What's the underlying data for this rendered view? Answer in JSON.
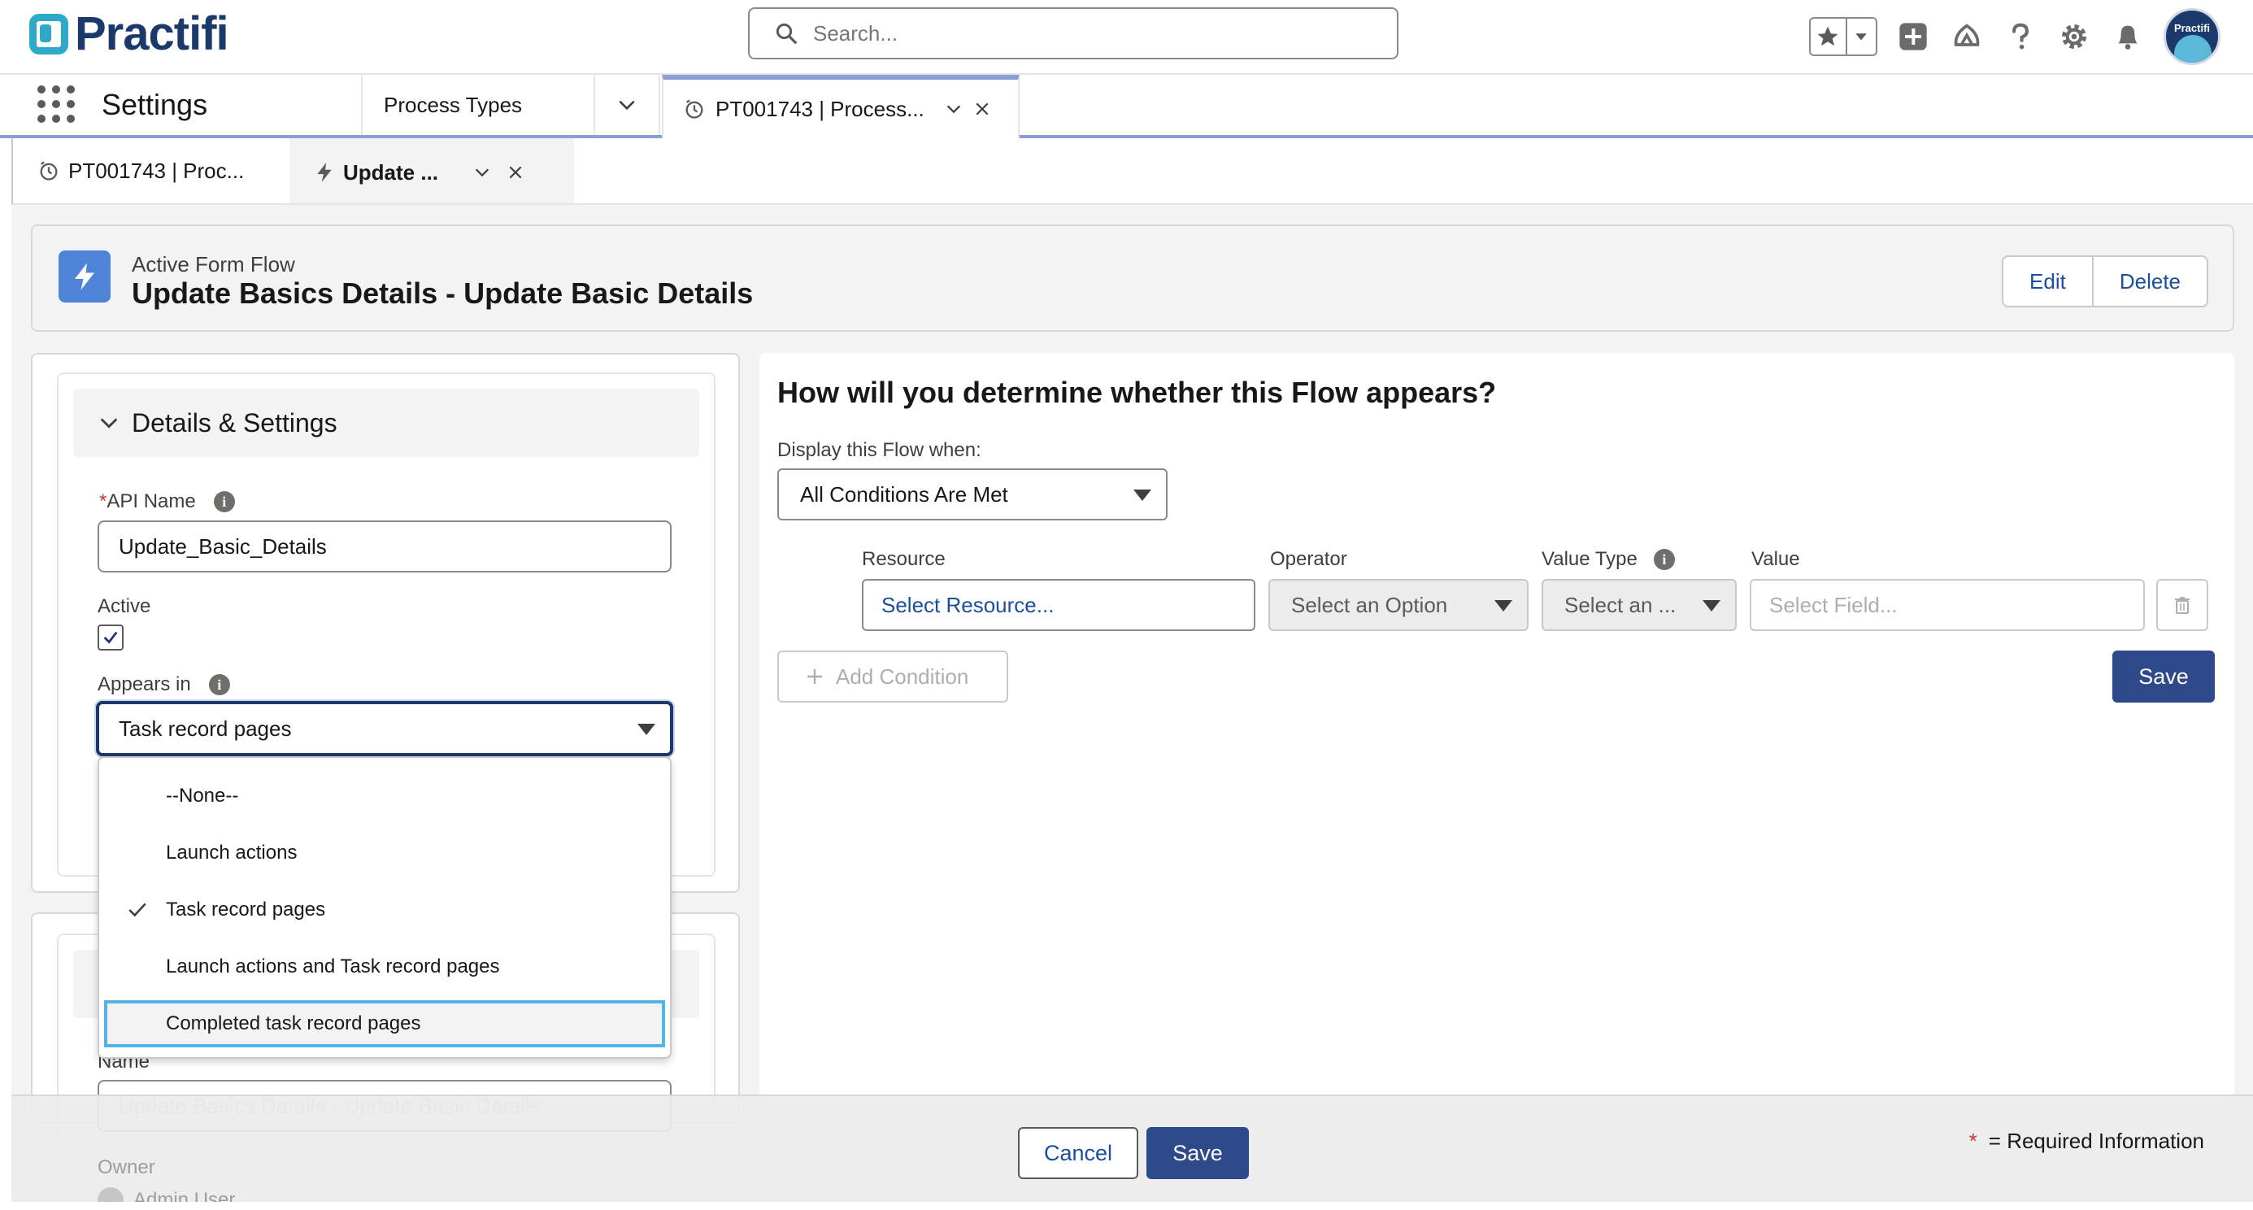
{
  "header": {
    "logo_text": "Practifi",
    "search_placeholder": "Search...",
    "avatar_text": "Practifi"
  },
  "app_nav": {
    "app_name": "Settings",
    "nav_item": "Process Types",
    "active_tab": "PT001743 | Process..."
  },
  "subtabs": [
    {
      "label": "PT001743 | Proc..."
    },
    {
      "label": "Update ..."
    }
  ],
  "record": {
    "type_label": "Active Form Flow",
    "title": "Update Basics Details - Update Basic Details",
    "edit_label": "Edit",
    "delete_label": "Delete"
  },
  "details": {
    "section_title": "Details & Settings",
    "api_name_label": "API Name",
    "api_name_required": "*",
    "api_name_value": "Update_Basic_Details",
    "active_label": "Active",
    "active_checked": true,
    "appears_in_label": "Appears in",
    "appears_in_value": "Task record pages",
    "name_label": "Name",
    "name_value": "Update Basics Details - Update Basic Details",
    "owner_label": "Owner",
    "owner_value": "Admin User"
  },
  "dropdown": {
    "options": [
      {
        "label": "--None--",
        "selected": false
      },
      {
        "label": "Launch actions",
        "selected": false
      },
      {
        "label": "Task record pages",
        "selected": true
      },
      {
        "label": "Launch actions and Task record pages",
        "selected": false
      },
      {
        "label": "Completed task record pages",
        "selected": false,
        "focused": true
      }
    ]
  },
  "conditions": {
    "title": "How will you determine whether this Flow appears?",
    "display_when_label": "Display this Flow when:",
    "display_when_value": "All Conditions Are Met",
    "resource_label": "Resource",
    "resource_placeholder": "Select Resource...",
    "operator_label": "Operator",
    "operator_value": "Select an Option",
    "value_type_label": "Value Type",
    "value_type_value": "Select an ...",
    "value_label": "Value",
    "value_placeholder": "Select Field...",
    "add_condition_label": "Add Condition",
    "save_label": "Save"
  },
  "footer": {
    "cancel_label": "Cancel",
    "save_label": "Save",
    "required_marker": "*",
    "required_text": "= Required Information"
  },
  "colors": {
    "brand_button": "#2f4a8a",
    "focus_ring": "#54b3e6",
    "logo_accent": "#2ea9c9",
    "flow_icon_bg": "#4e83d8",
    "required_star": "#c23934"
  }
}
